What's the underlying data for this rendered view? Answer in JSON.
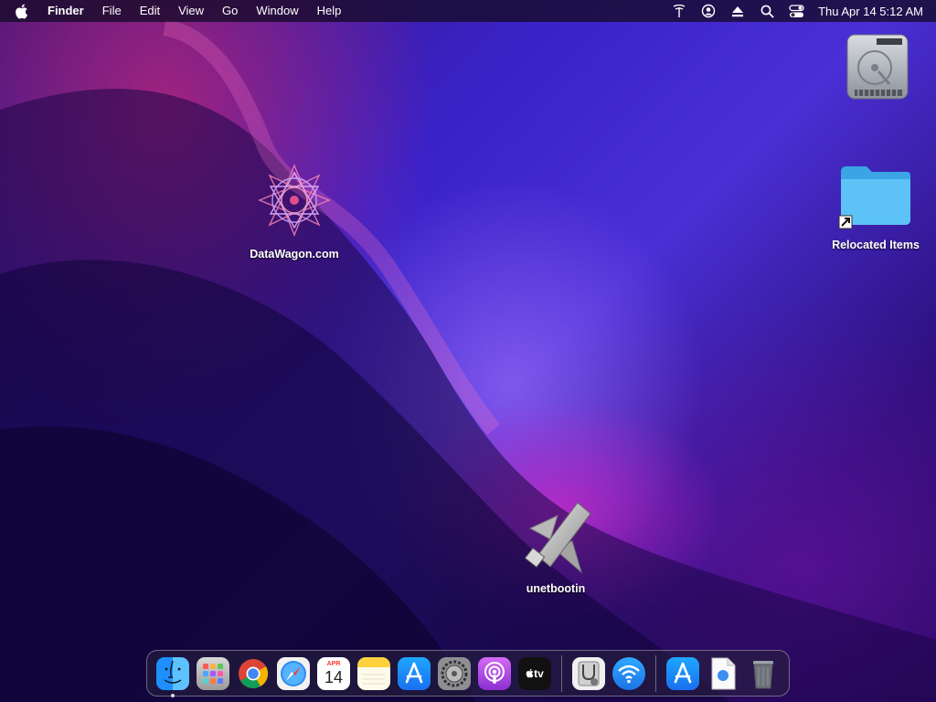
{
  "menubar": {
    "app_name": "Finder",
    "menus": [
      "File",
      "Edit",
      "View",
      "Go",
      "Window",
      "Help"
    ],
    "clock": "Thu Apr 14  5:12 AM",
    "status_icons": [
      "network-icon",
      "user-account-icon",
      "eject-icon",
      "search-icon",
      "control-center-icon"
    ]
  },
  "desktop": {
    "icons": [
      {
        "name": "Macintosh HD",
        "label": "",
        "icon": "hard-drive-icon"
      },
      {
        "name": "Relocated Items",
        "label": "Relocated Items",
        "icon": "folder-alias-icon"
      },
      {
        "name": "DataWagon.com",
        "label": "DataWagon.com",
        "icon": "datawagon-logo-icon"
      },
      {
        "name": "unetbootin",
        "label": "unetbootin",
        "icon": "unetbootin-icon"
      }
    ]
  },
  "dock": {
    "apps": [
      "Finder",
      "Launchpad",
      "Google Chrome",
      "Safari",
      "Calendar",
      "Notes",
      "App Store",
      "System Preferences",
      "Podcasts",
      "TV"
    ],
    "extras": [
      "Disk Utility",
      "Wireless Diagnostics"
    ],
    "right_items": [
      "App Store",
      "Document",
      "Trash"
    ],
    "calendar": {
      "month": "APR",
      "day": "14"
    },
    "tv_label": "tv"
  },
  "colors": {
    "wallpaper_primary": "#3a22c8",
    "wallpaper_accent": "#d22890",
    "folder_blue": "#43b5f0"
  }
}
